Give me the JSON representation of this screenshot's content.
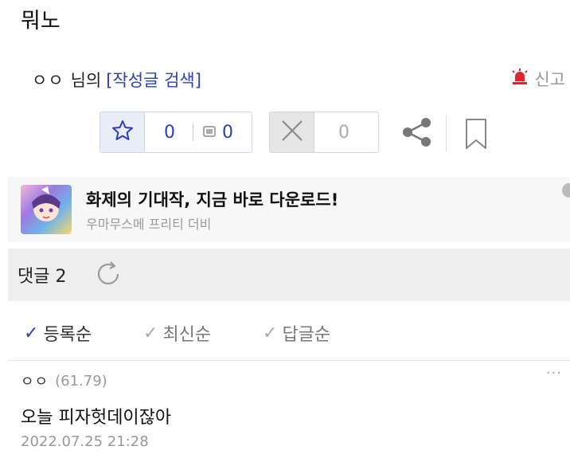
{
  "post": {
    "title": "뭐노"
  },
  "author": {
    "nickname": "ㅇㅇ",
    "suffix": "님의",
    "search_link": "[작성글 검색]"
  },
  "report": {
    "label": "신고",
    "icon": "siren-icon",
    "icon_color": "#e0262a"
  },
  "votes": {
    "recommend_icon": "star-thumb-icon",
    "recommend_count": "0",
    "fixed_icon": "fixed-member-icon",
    "fixed_recommend_count": "0",
    "downvote_icon": "x-icon",
    "downvote_count": "0"
  },
  "actions": {
    "share_icon": "share-icon",
    "bookmark_icon": "bookmark-icon"
  },
  "ad": {
    "title": "화제의 기대작, 지금 바로 다운로드!",
    "subtitle": "우마무스메 프리티 더비"
  },
  "comments": {
    "label": "댓글",
    "count": "2",
    "refresh_icon": "refresh-icon",
    "sort_options": [
      {
        "label": "등록순",
        "active": true
      },
      {
        "label": "최신순",
        "active": false
      },
      {
        "label": "답글순",
        "active": false
      }
    ],
    "items": [
      {
        "nickname": "ㅇㅇ",
        "ip": "(61.79)",
        "more": "···",
        "text": "오늘 피자헛데이잖아",
        "date": "2022.07.25 21:28"
      }
    ]
  },
  "colors": {
    "accent": "#2a3fb8",
    "muted": "#999999"
  }
}
